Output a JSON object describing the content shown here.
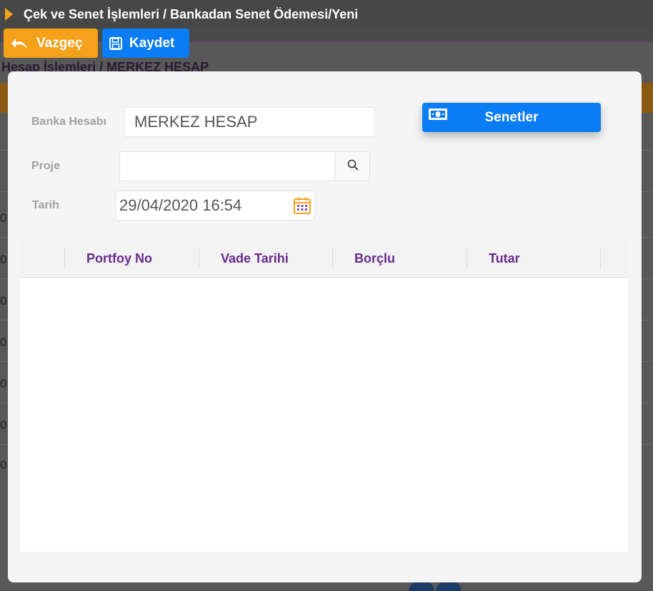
{
  "header": {
    "title": "Çek ve Senet İşlemleri / Bankadan Senet Ödemesi/Yeni"
  },
  "toolbar": {
    "cancel_label": "Vazgeç",
    "save_label": "Kaydet"
  },
  "background": {
    "breadcrumb": "Hesap İşlemleri / MERKEZ HESAP",
    "row_digit": "0"
  },
  "form": {
    "bank_account_label": "Banka Hesabı",
    "bank_account_value": "MERKEZ HESAP",
    "project_label": "Proje",
    "project_value": "",
    "date_label": "Tarih",
    "date_value": "29/04/2020 16:54",
    "senetler_button": "Senetler"
  },
  "grid": {
    "columns": [
      "Portfoy No",
      "Vade Tarihi",
      "Borçlu",
      "Tutar"
    ],
    "rows": []
  },
  "colors": {
    "accent_orange": "#f5a21a",
    "accent_blue": "#0a7cf4",
    "header_purple": "#6a2a8e"
  }
}
